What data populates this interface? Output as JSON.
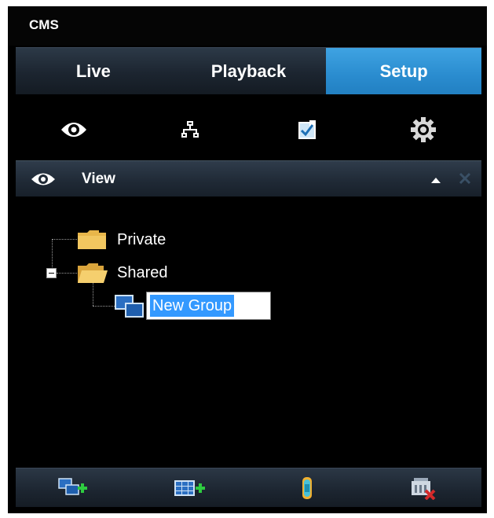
{
  "app": {
    "title": "CMS"
  },
  "tabs": [
    {
      "label": "Live",
      "active": false
    },
    {
      "label": "Playback",
      "active": false
    },
    {
      "label": "Setup",
      "active": true
    }
  ],
  "toolbar": [
    {
      "icon": "eye-icon"
    },
    {
      "icon": "network-icon"
    },
    {
      "icon": "checklist-icon",
      "selected": true
    },
    {
      "icon": "gear-icon"
    }
  ],
  "panel": {
    "title": "View",
    "icon": "eye-icon"
  },
  "tree": {
    "nodes": [
      {
        "label": "Private",
        "icon": "folder-closed-icon"
      },
      {
        "label": "Shared",
        "icon": "folder-open-icon",
        "expanded": true
      },
      {
        "label": "New Group",
        "icon": "view-group-icon",
        "editing": true
      }
    ]
  },
  "bottom_buttons": [
    {
      "icon": "add-group-icon"
    },
    {
      "icon": "add-layout-icon"
    },
    {
      "icon": "camera-icon"
    },
    {
      "icon": "delete-icon"
    }
  ],
  "colors": {
    "accent": "#2a8ccf",
    "background": "#000000",
    "header": "#1f2935",
    "selection": "#3399ff",
    "add_green": "#2ecc40",
    "delete_red": "#d42a2a"
  }
}
